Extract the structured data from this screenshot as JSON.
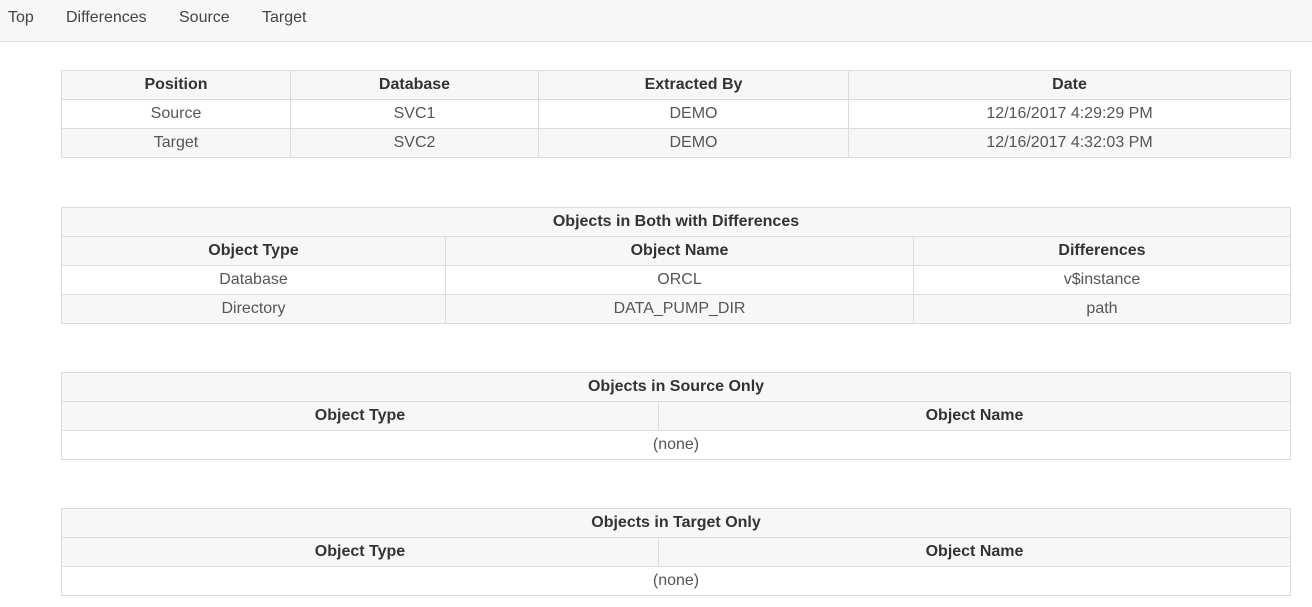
{
  "nav": {
    "items": [
      "Top",
      "Differences",
      "Source",
      "Target"
    ]
  },
  "summary": {
    "headers": [
      "Position",
      "Database",
      "Extracted By",
      "Date"
    ],
    "rows": [
      [
        "Source",
        "SVC1",
        "DEMO",
        "12/16/2017 4:29:29 PM"
      ],
      [
        "Target",
        "SVC2",
        "DEMO",
        "12/16/2017 4:32:03 PM"
      ]
    ]
  },
  "both": {
    "title": "Objects in Both with Differences",
    "headers": [
      "Object Type",
      "Object Name",
      "Differences"
    ],
    "rows": [
      [
        "Database",
        "ORCL",
        "v$instance"
      ],
      [
        "Directory",
        "DATA_PUMP_DIR",
        "path"
      ]
    ]
  },
  "source_only": {
    "title": "Objects in Source Only",
    "headers": [
      "Object Type",
      "Object Name"
    ],
    "empty": "(none)"
  },
  "target_only": {
    "title": "Objects in Target Only",
    "headers": [
      "Object Type",
      "Object Name"
    ],
    "empty": "(none)"
  },
  "colors": {
    "header_bg": "#f7f7f7",
    "border": "#dcdcdc",
    "text": "#333333"
  }
}
